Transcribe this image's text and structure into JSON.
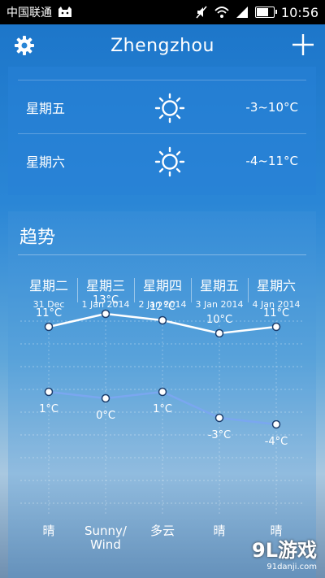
{
  "status": {
    "carrier": "中国联通",
    "time": "10:56",
    "battery_level": 0.8
  },
  "header": {
    "title": "Zhengzhou"
  },
  "forecast": [
    {
      "day": "星期五",
      "range": "-3~10°C",
      "icon": "sun-icon"
    },
    {
      "day": "星期六",
      "range": "-4~11°C",
      "icon": "sun-icon"
    }
  ],
  "trend": {
    "title": "趋势",
    "columns": [
      {
        "weekday": "星期二",
        "date": "31 Dec",
        "condition": "晴"
      },
      {
        "weekday": "星期三",
        "date": "1 Jan 2014",
        "condition": "Sunny/\nWind"
      },
      {
        "weekday": "星期四",
        "date": "2 Jan 2014",
        "condition": "多云"
      },
      {
        "weekday": "星期五",
        "date": "3 Jan 2014",
        "condition": "晴"
      },
      {
        "weekday": "星期六",
        "date": "4 Jan 2014",
        "condition": "晴"
      }
    ]
  },
  "chart_data": {
    "type": "line",
    "x": [
      "31 Dec",
      "1 Jan 2014",
      "2 Jan 2014",
      "3 Jan 2014",
      "4 Jan 2014"
    ],
    "series": [
      {
        "values": [
          11,
          13,
          12,
          10,
          11
        ],
        "labels": [
          "11°C",
          "13°C",
          "12°C",
          "10°C",
          "11°C"
        ],
        "color": "#ffffff"
      },
      {
        "values": [
          1,
          0,
          1,
          -3,
          -4
        ],
        "labels": [
          "1°C",
          "0°C",
          "1°C",
          "-3°C",
          "-4°C"
        ],
        "color": "#7aa7f0"
      }
    ],
    "grid": true
  },
  "watermark": {
    "main": "9L游戏",
    "sub": "91danji.com"
  }
}
